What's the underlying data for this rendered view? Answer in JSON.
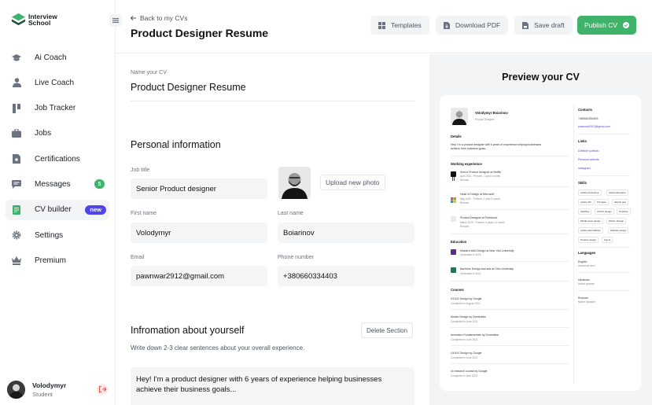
{
  "brand": {
    "line1": "Interview",
    "line2": "School"
  },
  "sidebar": {
    "items": [
      {
        "label": "Ai Coach",
        "icon": "graduation-cap-icon"
      },
      {
        "label": "Live Coach",
        "icon": "person-icon"
      },
      {
        "label": "Job Tracker",
        "icon": "kanban-icon"
      },
      {
        "label": "Jobs",
        "icon": "briefcase-icon"
      },
      {
        "label": "Certifications",
        "icon": "certificate-icon"
      },
      {
        "label": "Messages",
        "icon": "chat-icon",
        "badge": "5"
      },
      {
        "label": "CV builder",
        "icon": "document-icon",
        "badge": "new"
      },
      {
        "label": "Settings",
        "icon": "gear-icon"
      },
      {
        "label": "Premium",
        "icon": "crown-icon"
      }
    ],
    "user": {
      "name": "Volodymyr",
      "role": "Student"
    }
  },
  "header": {
    "back": "Back to my CVs",
    "title": "Product Designer Resume",
    "templates": "Templates",
    "download": "Download PDF",
    "save": "Save draft",
    "publish": "Publish CV"
  },
  "form": {
    "name_label": "Name your CV",
    "name_value": "Product Designer Resume",
    "personal_title": "Personal information",
    "job_title_label": "Job title",
    "job_title": "Senior Product designer",
    "upload": "Upload new photo",
    "first_name_label": "First name",
    "first_name": "Volodymyr",
    "last_name_label": "Last name",
    "last_name": "Boiarinov",
    "email_label": "Email",
    "email": "pawnwar2912@gmail.com",
    "phone_label": "Phone number",
    "phone": "+380660334403",
    "about_title": "Infromation about yourself",
    "delete": "Delete Section",
    "help": "Write down 2-3 clear sentences about your overall experience.",
    "about": "Hey! I'm a product designer with 6 years of experience helping businesses achieve their business goals..."
  },
  "preview": {
    "title": "Preview your CV",
    "name": "Volodymyr Boiarinov",
    "role": "Product Designer",
    "details_h": "Details",
    "details": [
      "Hey! I'm a product designer with 6 years of experience helping businesses",
      "achieve their business goals..."
    ],
    "exp_h": "Working experience",
    "exp": [
      {
        "t": "Senior Product designer at Netflix",
        "d": "April 2021 - Present, 1 year 6 month",
        "m": "Remote"
      },
      {
        "t": "Head of Design at Microsoft",
        "d": "May 2020 - Present, 1 year 5 month",
        "m": "Remote"
      },
      {
        "t": "Product Designer at Freelance",
        "d": "March 2015 - Present, 6 years 11 month",
        "m": "Remote"
      }
    ],
    "edu_h": "Education",
    "edu": [
      {
        "t": "Masters Web Design at New York University",
        "d": "Graduated in 2016"
      },
      {
        "t": "Bachelor Design and arts at Ohio University",
        "d": "Graduated in 2014"
      }
    ],
    "courses_h": "Courses",
    "courses": [
      {
        "t": "UX/UX Design by Google",
        "d": "Completed in August 2021"
      },
      {
        "t": "Motion Design by Domestika",
        "d": "Completed in June 2021"
      },
      {
        "t": "Animation Fundamentals by Domestika",
        "d": "Completed in June 2021"
      },
      {
        "t": "UX/UX Design by Google",
        "d": "Completed in June 2021"
      },
      {
        "t": "UI research course by Google",
        "d": "Completed in April 2022"
      }
    ],
    "contacts_h": "Contacts",
    "phone": "+380660334403",
    "email": "pawnwar2912@gmail.com",
    "links_h": "Links",
    "links": [
      "Dribbble portfolio",
      "Personal website",
      "Instagram"
    ],
    "skills_h": "Skills",
    "skills": [
      "Adobe photoshop",
      "Adobe Illustrator",
      "Adobe XD",
      "Principle",
      "Sketch app",
      "Webflow",
      "UX/UX design",
      "ProtoPie",
      "Mobile apps design",
      "Motion Design",
      "Adobe After Effects",
      "Website design",
      "Product design",
      "Figma"
    ],
    "lang_h": "Languages",
    "langs": [
      {
        "t": "English",
        "d": "Advanced level"
      },
      {
        "t": "Ukrainian",
        "d": "Native speaker"
      },
      {
        "t": "Russian",
        "d": "Native Speaker"
      }
    ]
  },
  "colors": {
    "accent": "#3fb36a",
    "badge_new": "#4f46e5",
    "preview_bg": "#f3f4f6"
  }
}
